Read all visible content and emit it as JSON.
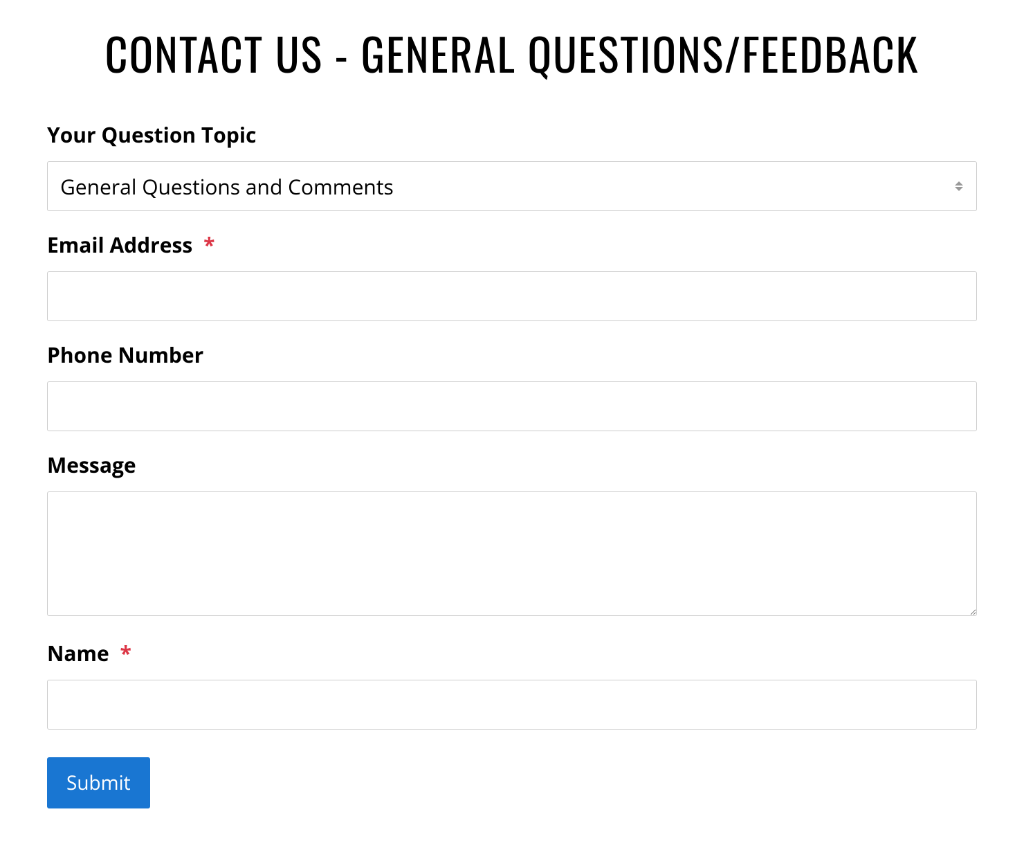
{
  "page": {
    "title": "CONTACT US - GENERAL QUESTIONS/FEEDBACK"
  },
  "form": {
    "topic": {
      "label": "Your Question Topic",
      "selected": "General Questions and Comments"
    },
    "email": {
      "label": "Email Address",
      "required_star": "*",
      "value": ""
    },
    "phone": {
      "label": "Phone Number",
      "value": ""
    },
    "message": {
      "label": "Message",
      "value": ""
    },
    "name": {
      "label": "Name",
      "required_star": "*",
      "value": ""
    },
    "submit_label": "Submit"
  }
}
